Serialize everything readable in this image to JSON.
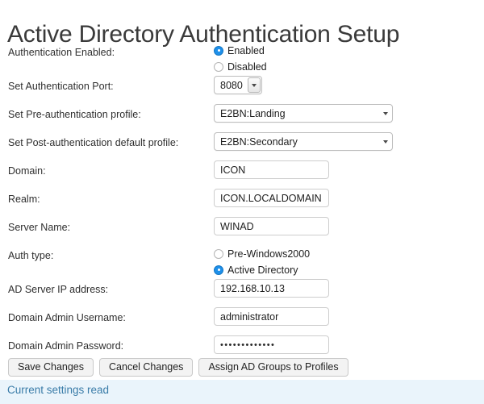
{
  "page": {
    "title": "Active Directory Authentication Setup"
  },
  "form": {
    "auth_enabled": {
      "label": "Authentication Enabled:",
      "options": [
        {
          "label": "Enabled",
          "selected": true
        },
        {
          "label": "Disabled",
          "selected": false
        }
      ]
    },
    "auth_port": {
      "label": "Set Authentication Port:",
      "value": "8080"
    },
    "pre_auth_profile": {
      "label": "Set Pre-authentication profile:",
      "value": "E2BN:Landing"
    },
    "post_auth_profile": {
      "label": "Set Post-authentication default profile:",
      "value": "E2BN:Secondary"
    },
    "domain": {
      "label": "Domain:",
      "value": "ICON"
    },
    "realm": {
      "label": "Realm:",
      "value": "ICON.LOCALDOMAIN"
    },
    "server_name": {
      "label": "Server Name:",
      "value": "WINAD"
    },
    "auth_type": {
      "label": "Auth type:",
      "options": [
        {
          "label": "Pre-Windows2000",
          "selected": false
        },
        {
          "label": "Active Directory",
          "selected": true
        }
      ]
    },
    "ad_server_ip": {
      "label": "AD Server IP address:",
      "value": "192.168.10.13"
    },
    "admin_username": {
      "label": "Domain Admin Username:",
      "value": "administrator"
    },
    "admin_password": {
      "label": "Domain Admin Password:",
      "value": "•••••••••••••"
    }
  },
  "buttons": {
    "save": "Save Changes",
    "cancel": "Cancel Changes",
    "assign": "Assign AD Groups to Profiles"
  },
  "status": {
    "message": "Current settings read"
  },
  "icons": {
    "dropdown_arrow": "chevron-down-icon"
  },
  "colors": {
    "accent": "#1e90ea",
    "status_text": "#3a7ca8",
    "status_bg": "#eaf4fb"
  }
}
